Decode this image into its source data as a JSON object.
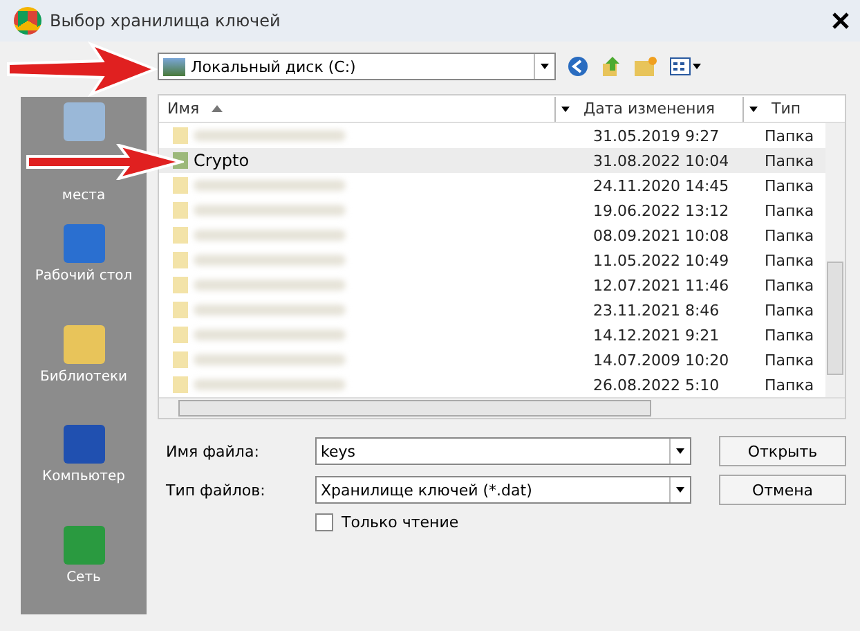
{
  "window": {
    "title": "Выбор хранилища ключей"
  },
  "location": {
    "value": "Локальный диск (C:)"
  },
  "sidebar": {
    "items": [
      {
        "label": "места"
      },
      {
        "label": "Рабочий стол"
      },
      {
        "label": "Библиотеки"
      },
      {
        "label": "Компьютер"
      },
      {
        "label": "Сеть"
      }
    ]
  },
  "table": {
    "columns": [
      "Имя",
      "Дата изменения",
      "Тип"
    ],
    "rows": [
      {
        "name": null,
        "date": "31.05.2019 9:27",
        "type": "Папка",
        "selected": false
      },
      {
        "name": "Crypto",
        "date": "31.08.2022 10:04",
        "type": "Папка",
        "selected": true
      },
      {
        "name": null,
        "date": "24.11.2020 14:45",
        "type": "Папка",
        "selected": false
      },
      {
        "name": null,
        "date": "19.06.2022 13:12",
        "type": "Папка",
        "selected": false
      },
      {
        "name": null,
        "date": "08.09.2021 10:08",
        "type": "Папка",
        "selected": false
      },
      {
        "name": null,
        "date": "11.05.2022 10:49",
        "type": "Папка",
        "selected": false
      },
      {
        "name": null,
        "date": "12.07.2021 11:46",
        "type": "Папка",
        "selected": false
      },
      {
        "name": null,
        "date": "23.11.2021 8:46",
        "type": "Папка",
        "selected": false
      },
      {
        "name": null,
        "date": "14.12.2021 9:21",
        "type": "Папка",
        "selected": false
      },
      {
        "name": null,
        "date": "14.07.2009 10:20",
        "type": "Папка",
        "selected": false
      },
      {
        "name": null,
        "date": "26.08.2022 5:10",
        "type": "Папка",
        "selected": false
      }
    ]
  },
  "file_name": {
    "label": "Имя файла:",
    "value": "keys"
  },
  "file_type": {
    "label": "Тип файлов:",
    "value": "Хранилище ключей (*.dat)"
  },
  "buttons": [
    "Открыть",
    "Отмена"
  ],
  "read_only": {
    "label": "Только чтение",
    "checked": false
  }
}
